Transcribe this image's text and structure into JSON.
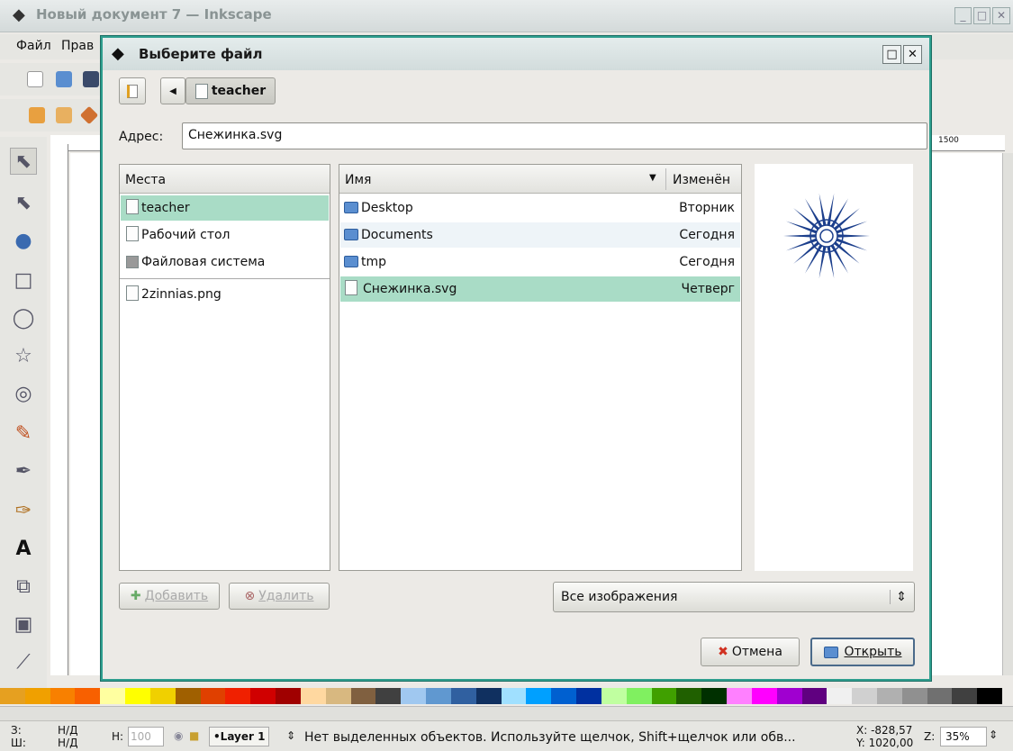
{
  "main_window": {
    "title": "Новый документ 7 — Inkscape",
    "menu": [
      "Файл",
      "Прав"
    ],
    "ruler_label": "1500"
  },
  "dialog": {
    "title": "Выберите файл",
    "path_button": "teacher",
    "address_label": "Адрес:",
    "address_value": "Снежинка.svg",
    "places": {
      "header": "Места",
      "items": [
        "teacher",
        "Рабочий стол",
        "Файловая система"
      ],
      "bookmarks": [
        "2zinnias.png"
      ]
    },
    "files": {
      "header_name": "Имя",
      "header_modified": "Изменён",
      "rows": [
        {
          "name": "Desktop",
          "modified": "Вторник",
          "type": "folder"
        },
        {
          "name": "Documents",
          "modified": "Сегодня",
          "type": "folder"
        },
        {
          "name": "tmp",
          "modified": "Сегодня",
          "type": "folder"
        },
        {
          "name": "Снежинка.svg",
          "modified": "Четверг",
          "type": "file"
        }
      ]
    },
    "add_button": "Добавить",
    "remove_button": "Удалить",
    "filter": "Все изображения",
    "cancel_button": "Отмена",
    "open_button": "Открыть"
  },
  "statusbar": {
    "fill_label": "З:",
    "stroke_label": "Ш:",
    "fill_value": "Н/Д",
    "stroke_value": "Н/Д",
    "opacity_label": "Н:",
    "opacity_value": "100",
    "layer": "•Layer 1",
    "message": "Нет выделенных объектов. Используйте щелчок, Shift+щелчок или обв...",
    "x_coord": "X: -828,57",
    "y_coord": "Y: 1020,00",
    "zoom_label": "Z:",
    "zoom": "35%"
  },
  "colors": {
    "selection": "#a9dcc6",
    "dialog_border": "#2e9e8e",
    "snowflake": "#1c3f8c"
  },
  "palette": [
    "#e6a020",
    "#f0a000",
    "#f88000",
    "#f86000",
    "#ffffa0",
    "#ffff00",
    "#f0d000",
    "#a06000",
    "#e04000",
    "#f02000",
    "#d00000",
    "#a00000",
    "#ffd8a0",
    "#d8b880",
    "#806040",
    "#404040",
    "#a0c8f0",
    "#6098d0",
    "#3060a0",
    "#103060",
    "#a0e0ff",
    "#00a0ff",
    "#0060d0",
    "#0030a0",
    "#c0ffa0",
    "#80f060",
    "#40a000",
    "#206000",
    "#003000",
    "#ff80ff",
    "#ff00ff",
    "#a000d0",
    "#600080",
    "#f0f0f0",
    "#d0d0d0",
    "#b0b0b0",
    "#909090",
    "#707070",
    "#404040",
    "#000000"
  ]
}
